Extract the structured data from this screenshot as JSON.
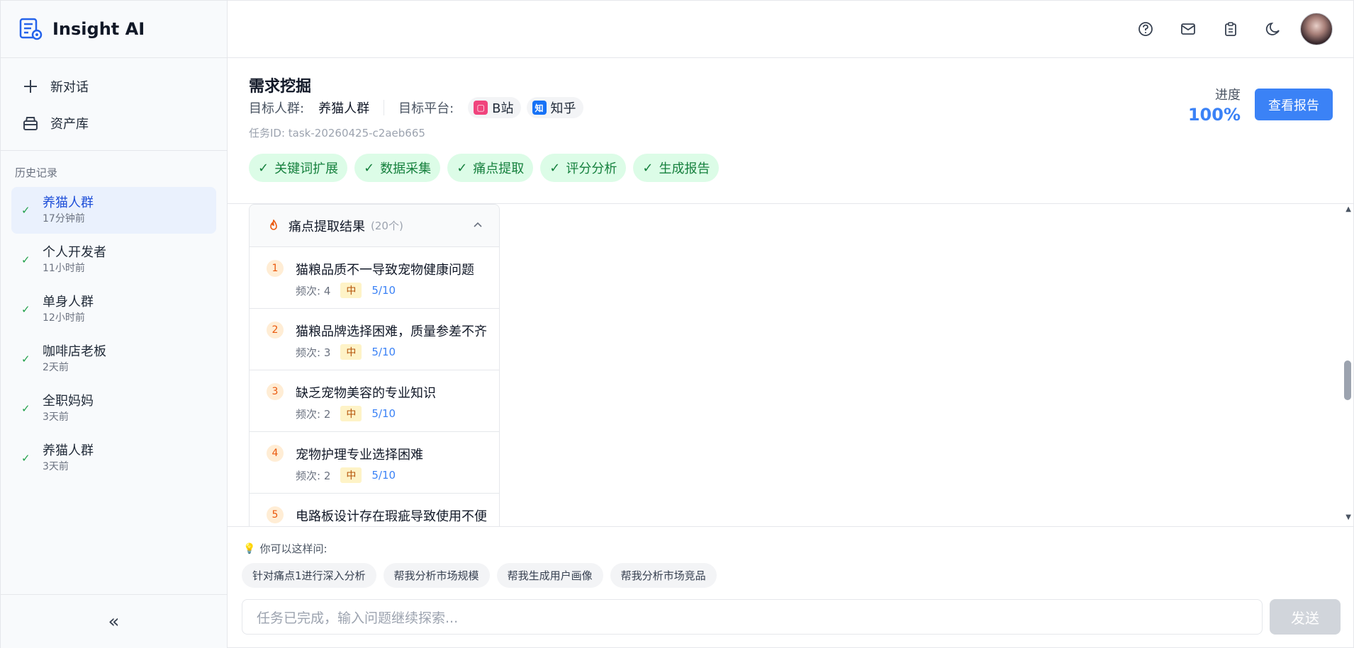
{
  "app": {
    "name": "Insight AI"
  },
  "sidebar": {
    "nav": [
      {
        "label": "新对话",
        "icon": "plus-icon"
      },
      {
        "label": "资产库",
        "icon": "archive-icon"
      }
    ],
    "history_title": "历史记录",
    "history": [
      {
        "title": "养猫人群",
        "time": "17分钟前",
        "active": true
      },
      {
        "title": "个人开发者",
        "time": "11小时前"
      },
      {
        "title": "单身人群",
        "time": "12小时前"
      },
      {
        "title": "咖啡店老板",
        "time": "2天前"
      },
      {
        "title": "全职妈妈",
        "time": "3天前"
      },
      {
        "title": "养猫人群",
        "time": "3天前"
      }
    ],
    "collapse_icon": "«"
  },
  "task": {
    "title": "需求挖掘",
    "audience_label": "目标人群:",
    "audience": "养猫人群",
    "platform_label": "目标平台:",
    "platforms": [
      {
        "name": "B站",
        "color": "#f0447d"
      },
      {
        "name": "知乎",
        "color": "#1772f6",
        "badge": "知"
      }
    ],
    "task_id": "任务ID: task-20260425-c2aeb665",
    "steps": [
      "关键词扩展",
      "数据采集",
      "痛点提取",
      "评分分析",
      "生成报告"
    ],
    "progress_label": "进度",
    "progress_value": "100%",
    "report_button": "查看报告"
  },
  "results": {
    "title": "痛点提取结果",
    "count": "(20个)",
    "items": [
      {
        "num": "1",
        "text": "猫粮品质不一导致宠物健康问题",
        "freq": "频次: 4",
        "level": "中",
        "score": "5/10"
      },
      {
        "num": "2",
        "text": "猫粮品牌选择困难，质量参差不齐",
        "freq": "频次: 3",
        "level": "中",
        "score": "5/10"
      },
      {
        "num": "3",
        "text": "缺乏宠物美容的专业知识",
        "freq": "频次: 2",
        "level": "中",
        "score": "5/10"
      },
      {
        "num": "4",
        "text": "宠物护理专业选择困难",
        "freq": "频次: 2",
        "level": "中",
        "score": "5/10"
      },
      {
        "num": "5",
        "text": "电路板设计存在瑕疵导致使用不便",
        "freq": "",
        "level": "",
        "score": ""
      }
    ]
  },
  "suggest": {
    "hint": "你可以这样问:",
    "chips": [
      "针对痛点1进行深入分析",
      "帮我分析市场规模",
      "帮我生成用户画像",
      "帮我分析市场竞品"
    ]
  },
  "composer": {
    "placeholder": "任务已完成，输入问题继续探索...",
    "send": "发送"
  },
  "colors": {
    "accent": "#3b82f6",
    "success": "#15803d",
    "success_bg": "#dcfce7"
  }
}
